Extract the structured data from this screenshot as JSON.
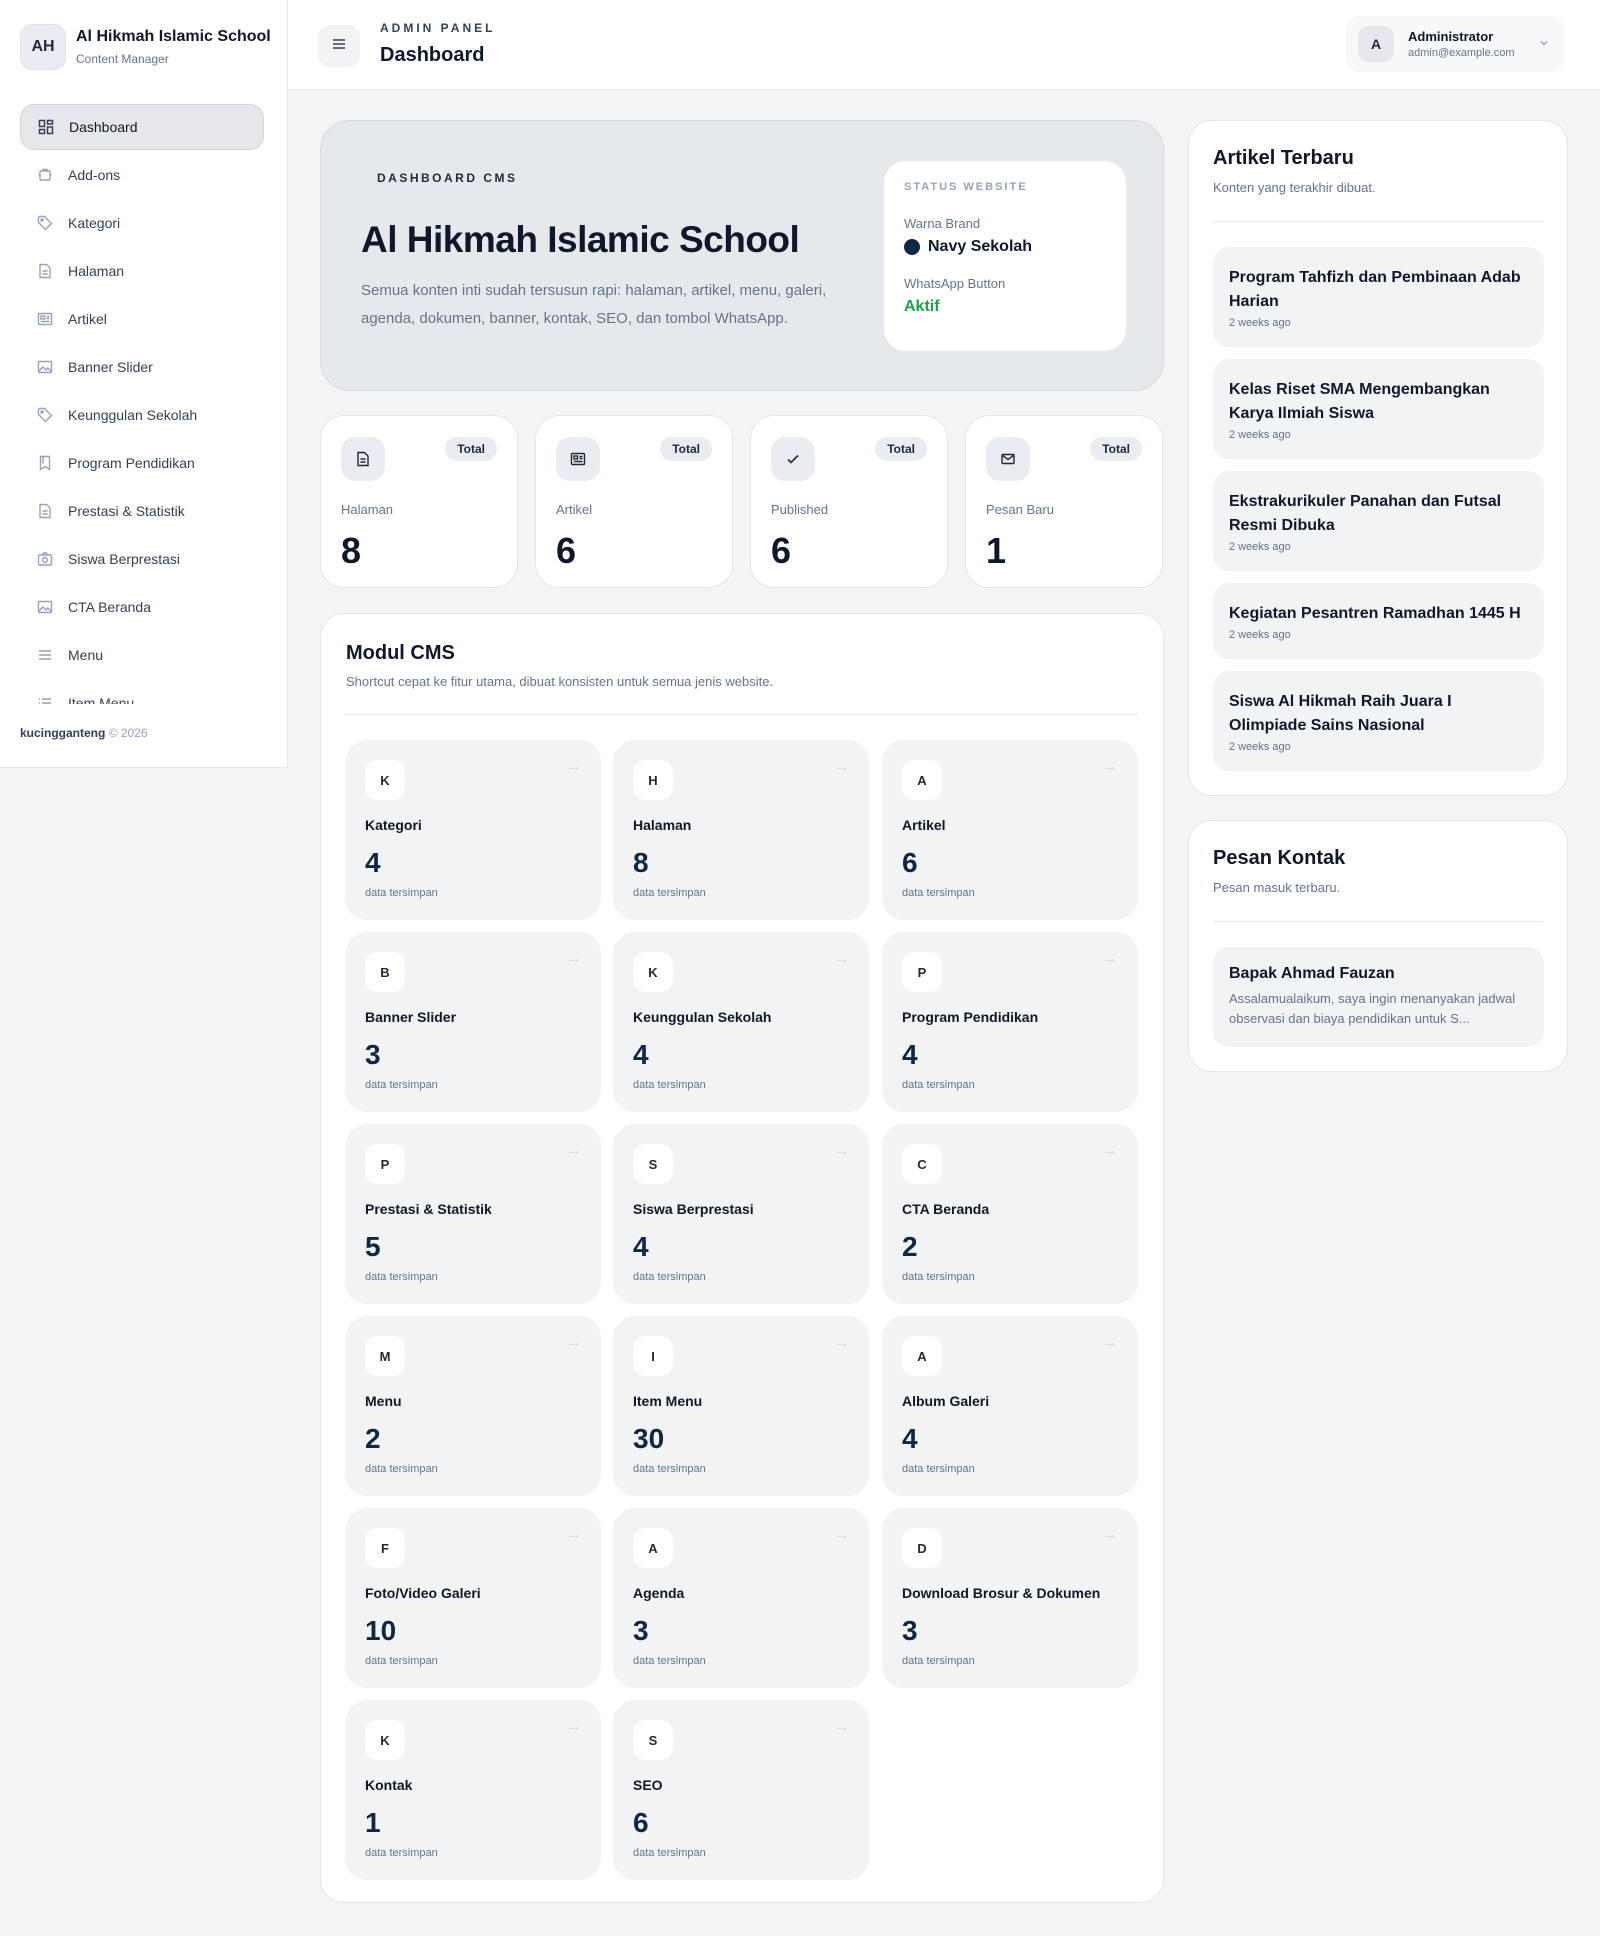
{
  "sidebar": {
    "brand_initials": "AH",
    "brand_title": "Al Hikmah Islamic School",
    "brand_subtitle": "Content Manager",
    "items": [
      {
        "label": "Dashboard",
        "icon": "dashboard-icon",
        "active": true
      },
      {
        "label": "Add-ons",
        "icon": "addons-icon"
      },
      {
        "label": "Kategori",
        "icon": "tag-icon"
      },
      {
        "label": "Halaman",
        "icon": "page-icon"
      },
      {
        "label": "Artikel",
        "icon": "article-icon"
      },
      {
        "label": "Banner Slider",
        "icon": "image-icon"
      },
      {
        "label": "Keunggulan Sekolah",
        "icon": "tag-icon"
      },
      {
        "label": "Program Pendidikan",
        "icon": "bookmark-icon"
      },
      {
        "label": "Prestasi & Statistik",
        "icon": "page-icon"
      },
      {
        "label": "Siswa Berprestasi",
        "icon": "camera-icon"
      },
      {
        "label": "CTA Beranda",
        "icon": "image-icon"
      },
      {
        "label": "Menu",
        "icon": "menu-icon"
      },
      {
        "label": "Item Menu",
        "icon": "list-icon"
      }
    ],
    "footer_brand": "kucingganteng",
    "footer_year": "© 2026"
  },
  "header": {
    "kicker": "ADMIN PANEL",
    "title": "Dashboard",
    "user_initial": "A",
    "user_name": "Administrator",
    "user_email": "admin@example.com"
  },
  "hero": {
    "kicker": "DASHBOARD CMS",
    "title": "Al Hikmah Islamic School",
    "description": "Semua konten inti sudah tersusun rapi: halaman, artikel, menu, galeri, agenda, dokumen, banner, kontak, SEO, dan tombol WhatsApp.",
    "status": {
      "kicker": "STATUS WEBSITE",
      "brand_label": "Warna Brand",
      "brand_value": "Navy Sekolah",
      "brand_color": "#0f2742",
      "whatsapp_label": "WhatsApp Button",
      "whatsapp_value": "Aktif",
      "active_color": "#16a34a"
    }
  },
  "stats": [
    {
      "label": "Halaman",
      "value": "8",
      "badge": "Total",
      "icon": "page-icon"
    },
    {
      "label": "Artikel",
      "value": "6",
      "badge": "Total",
      "icon": "article-icon"
    },
    {
      "label": "Published",
      "value": "6",
      "badge": "Total",
      "icon": "check-icon"
    },
    {
      "label": "Pesan Baru",
      "value": "1",
      "badge": "Total",
      "icon": "mail-icon"
    }
  ],
  "modules": {
    "title": "Modul CMS",
    "subtitle": "Shortcut cepat ke fitur utama, dibuat konsisten untuk semua jenis website.",
    "caption": "data tersimpan",
    "arrow": "→",
    "items": [
      {
        "letter": "K",
        "name": "Kategori",
        "count": "4"
      },
      {
        "letter": "H",
        "name": "Halaman",
        "count": "8"
      },
      {
        "letter": "A",
        "name": "Artikel",
        "count": "6"
      },
      {
        "letter": "B",
        "name": "Banner Slider",
        "count": "3"
      },
      {
        "letter": "K",
        "name": "Keunggulan Sekolah",
        "count": "4"
      },
      {
        "letter": "P",
        "name": "Program Pendidikan",
        "count": "4"
      },
      {
        "letter": "P",
        "name": "Prestasi & Statistik",
        "count": "5"
      },
      {
        "letter": "S",
        "name": "Siswa Berprestasi",
        "count": "4"
      },
      {
        "letter": "C",
        "name": "CTA Beranda",
        "count": "2"
      },
      {
        "letter": "M",
        "name": "Menu",
        "count": "2"
      },
      {
        "letter": "I",
        "name": "Item Menu",
        "count": "30"
      },
      {
        "letter": "A",
        "name": "Album Galeri",
        "count": "4"
      },
      {
        "letter": "F",
        "name": "Foto/Video Galeri",
        "count": "10"
      },
      {
        "letter": "A",
        "name": "Agenda",
        "count": "3"
      },
      {
        "letter": "D",
        "name": "Download Brosur & Dokumen",
        "count": "3"
      },
      {
        "letter": "K",
        "name": "Kontak",
        "count": "1"
      },
      {
        "letter": "S",
        "name": "SEO",
        "count": "6"
      }
    ]
  },
  "articles_panel": {
    "title": "Artikel Terbaru",
    "subtitle": "Konten yang terakhir dibuat.",
    "items": [
      {
        "title": "Program Tahfizh dan Pembinaan Adab Harian",
        "time": "2 weeks ago"
      },
      {
        "title": "Kelas Riset SMA Mengembangkan Karya Ilmiah Siswa",
        "time": "2 weeks ago"
      },
      {
        "title": "Ekstrakurikuler Panahan dan Futsal Resmi Dibuka",
        "time": "2 weeks ago"
      },
      {
        "title": "Kegiatan Pesantren Ramadhan 1445 H",
        "time": "2 weeks ago"
      },
      {
        "title": "Siswa Al Hikmah Raih Juara I Olimpiade Sains Nasional",
        "time": "2 weeks ago"
      }
    ]
  },
  "messages_panel": {
    "title": "Pesan Kontak",
    "subtitle": "Pesan masuk terbaru.",
    "items": [
      {
        "name": "Bapak Ahmad Fauzan",
        "text": "Assalamualaikum, saya ingin menanyakan jadwal observasi dan biaya pendidikan untuk S..."
      }
    ]
  }
}
